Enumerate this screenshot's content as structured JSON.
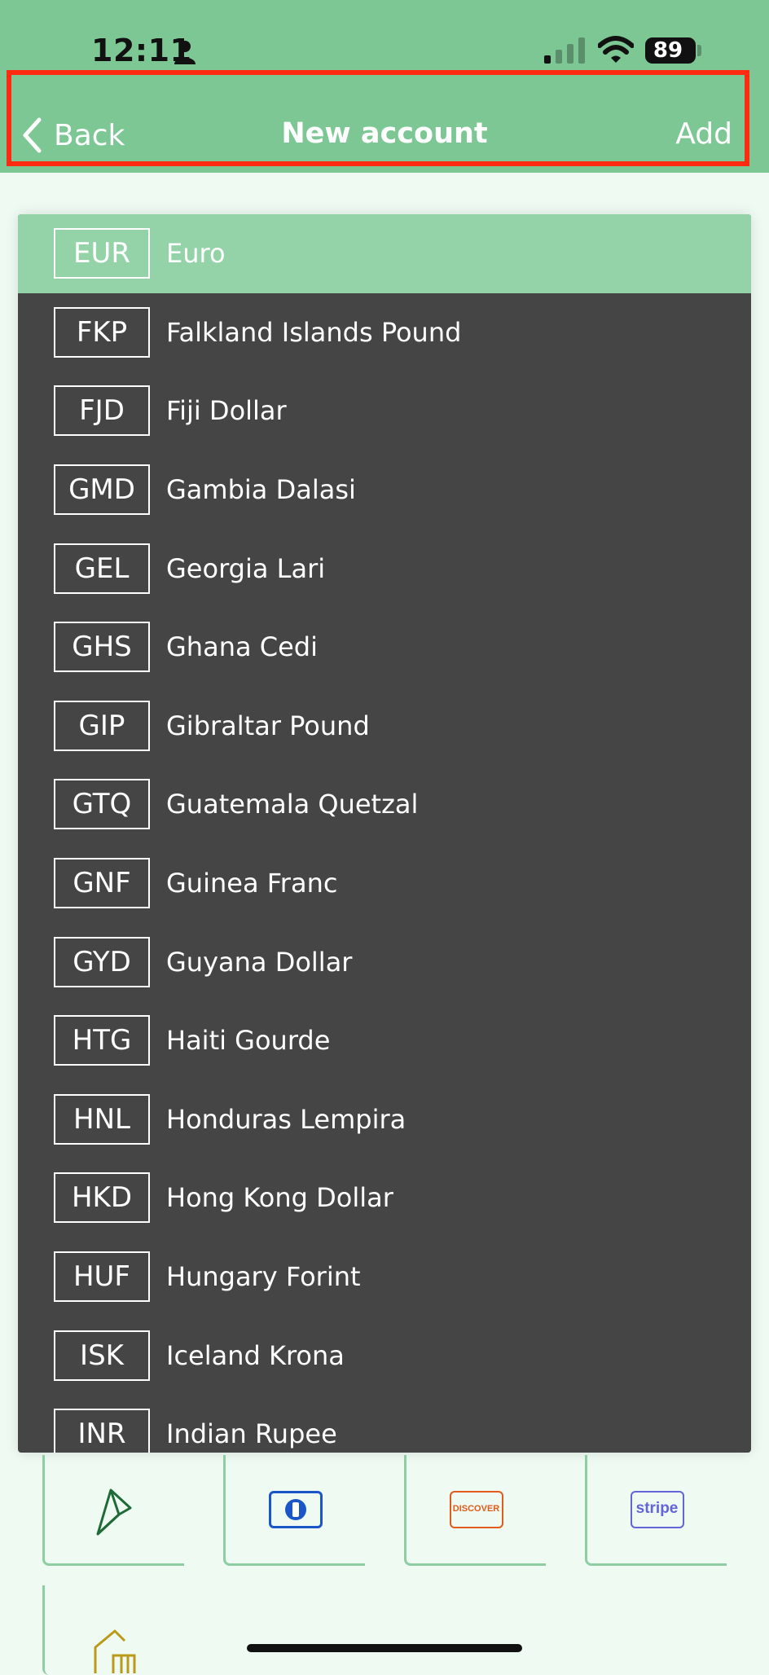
{
  "status_bar": {
    "time": "12:11",
    "battery": "89"
  },
  "nav": {
    "back_label": "Back",
    "title": "New account",
    "add_label": "Add"
  },
  "currencies": [
    {
      "code": "EUR",
      "name": "Euro",
      "selected": true
    },
    {
      "code": "FKP",
      "name": "Falkland Islands Pound"
    },
    {
      "code": "FJD",
      "name": "Fiji Dollar"
    },
    {
      "code": "GMD",
      "name": "Gambia Dalasi"
    },
    {
      "code": "GEL",
      "name": "Georgia Lari"
    },
    {
      "code": "GHS",
      "name": "Ghana Cedi"
    },
    {
      "code": "GIP",
      "name": "Gibraltar Pound"
    },
    {
      "code": "GTQ",
      "name": "Guatemala Quetzal"
    },
    {
      "code": "GNF",
      "name": "Guinea Franc"
    },
    {
      "code": "GYD",
      "name": "Guyana Dollar"
    },
    {
      "code": "HTG",
      "name": "Haiti Gourde"
    },
    {
      "code": "HNL",
      "name": "Honduras Lempira"
    },
    {
      "code": "HKD",
      "name": "Hong Kong Dollar"
    },
    {
      "code": "HUF",
      "name": "Hungary Forint"
    },
    {
      "code": "ISK",
      "name": "Iceland Krona"
    },
    {
      "code": "INR",
      "name": "Indian Rupee"
    }
  ],
  "payment_tiles": {
    "discover_text": "DISCOVER",
    "stripe_text": "stripe"
  },
  "icons": [
    "person-icon",
    "signal-icon",
    "wifi-icon",
    "chevron-left-icon",
    "fold-logo-icon",
    "diners-club-icon",
    "discover-icon",
    "stripe-icon",
    "house-icon"
  ],
  "colors": {
    "header": "#7cc794",
    "selected_row": "#94d3a8",
    "list_bg": "#454545",
    "highlight_outline": "#ff2a12"
  }
}
